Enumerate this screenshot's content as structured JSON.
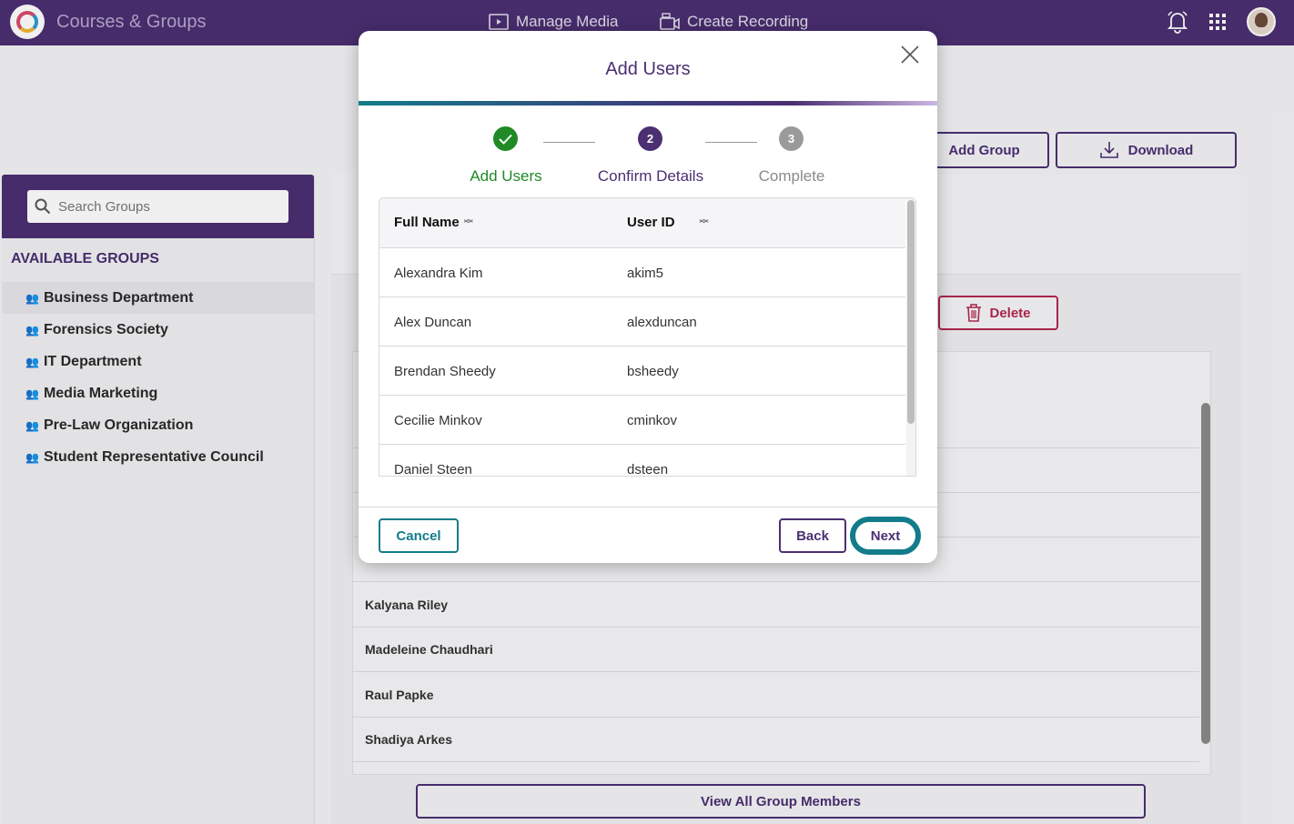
{
  "app": {
    "title": "Courses & Groups",
    "nav": [
      {
        "label": "Manage Media",
        "icon": "media-icon"
      },
      {
        "label": "Create Recording",
        "icon": "recording-icon"
      }
    ],
    "icons": [
      "bell-icon",
      "apps-grid-icon",
      "avatar"
    ]
  },
  "toolbar": {
    "add_group_label": "Add Group",
    "download_label": "Download",
    "delete_label": "Delete"
  },
  "sidebar": {
    "search_placeholder": "Search Groups",
    "heading": "AVAILABLE GROUPS",
    "groups": [
      "Business Department",
      "Forensics Society",
      "IT Department",
      "Media Marketing",
      "Pre-Law Organization",
      "Student Representative Council"
    ]
  },
  "members": {
    "rows": [
      "Kalyana Riley",
      "Madeleine Chaudhari",
      "Raul Papke",
      "Shadiya Arkes"
    ],
    "view_all_label": "View All Group Members"
  },
  "modal": {
    "title": "Add Users",
    "steps": [
      {
        "label": "Add Users",
        "state": "done",
        "number": "1"
      },
      {
        "label": "Confirm Details",
        "state": "current",
        "number": "2"
      },
      {
        "label": "Complete",
        "state": "pending",
        "number": "3"
      }
    ],
    "columns": [
      "Full Name",
      "User ID"
    ],
    "rows": [
      {
        "name": "Alexandra Kim",
        "id": "akim5"
      },
      {
        "name": "Alex Duncan",
        "id": "alexduncan"
      },
      {
        "name": "Brendan Sheedy",
        "id": "bsheedy"
      },
      {
        "name": "Cecilie Minkov",
        "id": "cminkov"
      },
      {
        "name": "Daniel Steen",
        "id": "dsteen"
      }
    ],
    "cancel_label": "Cancel",
    "back_label": "Back",
    "next_label": "Next"
  },
  "colors": {
    "brand": "#4b2f72",
    "teal": "#137c8a",
    "success": "#1f8a26",
    "danger": "#b3284f",
    "pending": "#9a9a9a"
  }
}
